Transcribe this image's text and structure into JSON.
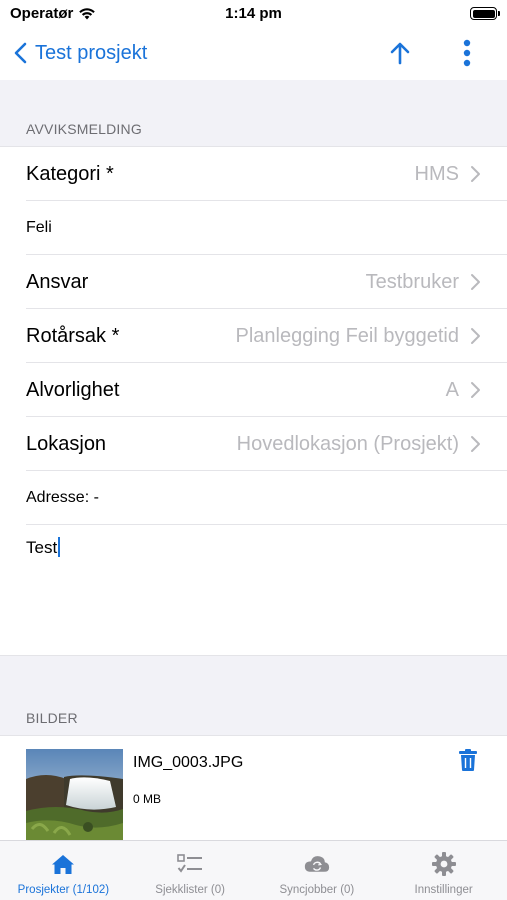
{
  "status_bar": {
    "carrier": "Operatør",
    "time": "1:14 pm"
  },
  "nav": {
    "back_label": "Test prosjekt"
  },
  "sections": {
    "form_header": "AVVIKSMELDING",
    "photos_header": "BILDER"
  },
  "form": {
    "rows": [
      {
        "label": "Kategori *",
        "value": "HMS"
      },
      {
        "label": "Feli",
        "value": ""
      },
      {
        "label": "Ansvar",
        "value": "Testbruker"
      },
      {
        "label": "Rotårsak *",
        "value": "Planlegging Feil byggetid"
      },
      {
        "label": "Alvorlighet",
        "value": "A"
      },
      {
        "label": "Lokasjon",
        "value": "Hovedlokasjon (Prosjekt)"
      },
      {
        "label": "Adresse: -",
        "value": ""
      }
    ],
    "description": "Test"
  },
  "photos": [
    {
      "file_name": "IMG_0003.JPG",
      "size": "0 MB"
    }
  ],
  "tabs": [
    {
      "label": "Prosjekter (1/102)",
      "icon": "home-icon",
      "active": true
    },
    {
      "label": "Sjekklister (0)",
      "icon": "checklist-icon",
      "active": false
    },
    {
      "label": "Syncjobber (0)",
      "icon": "cloud-sync-icon",
      "active": false
    },
    {
      "label": "Innstillinger",
      "icon": "gear-icon",
      "active": false
    }
  ],
  "colors": {
    "accent": "#1a73d9",
    "muted": "#b9b9bd",
    "background": "#f2f2f7"
  }
}
